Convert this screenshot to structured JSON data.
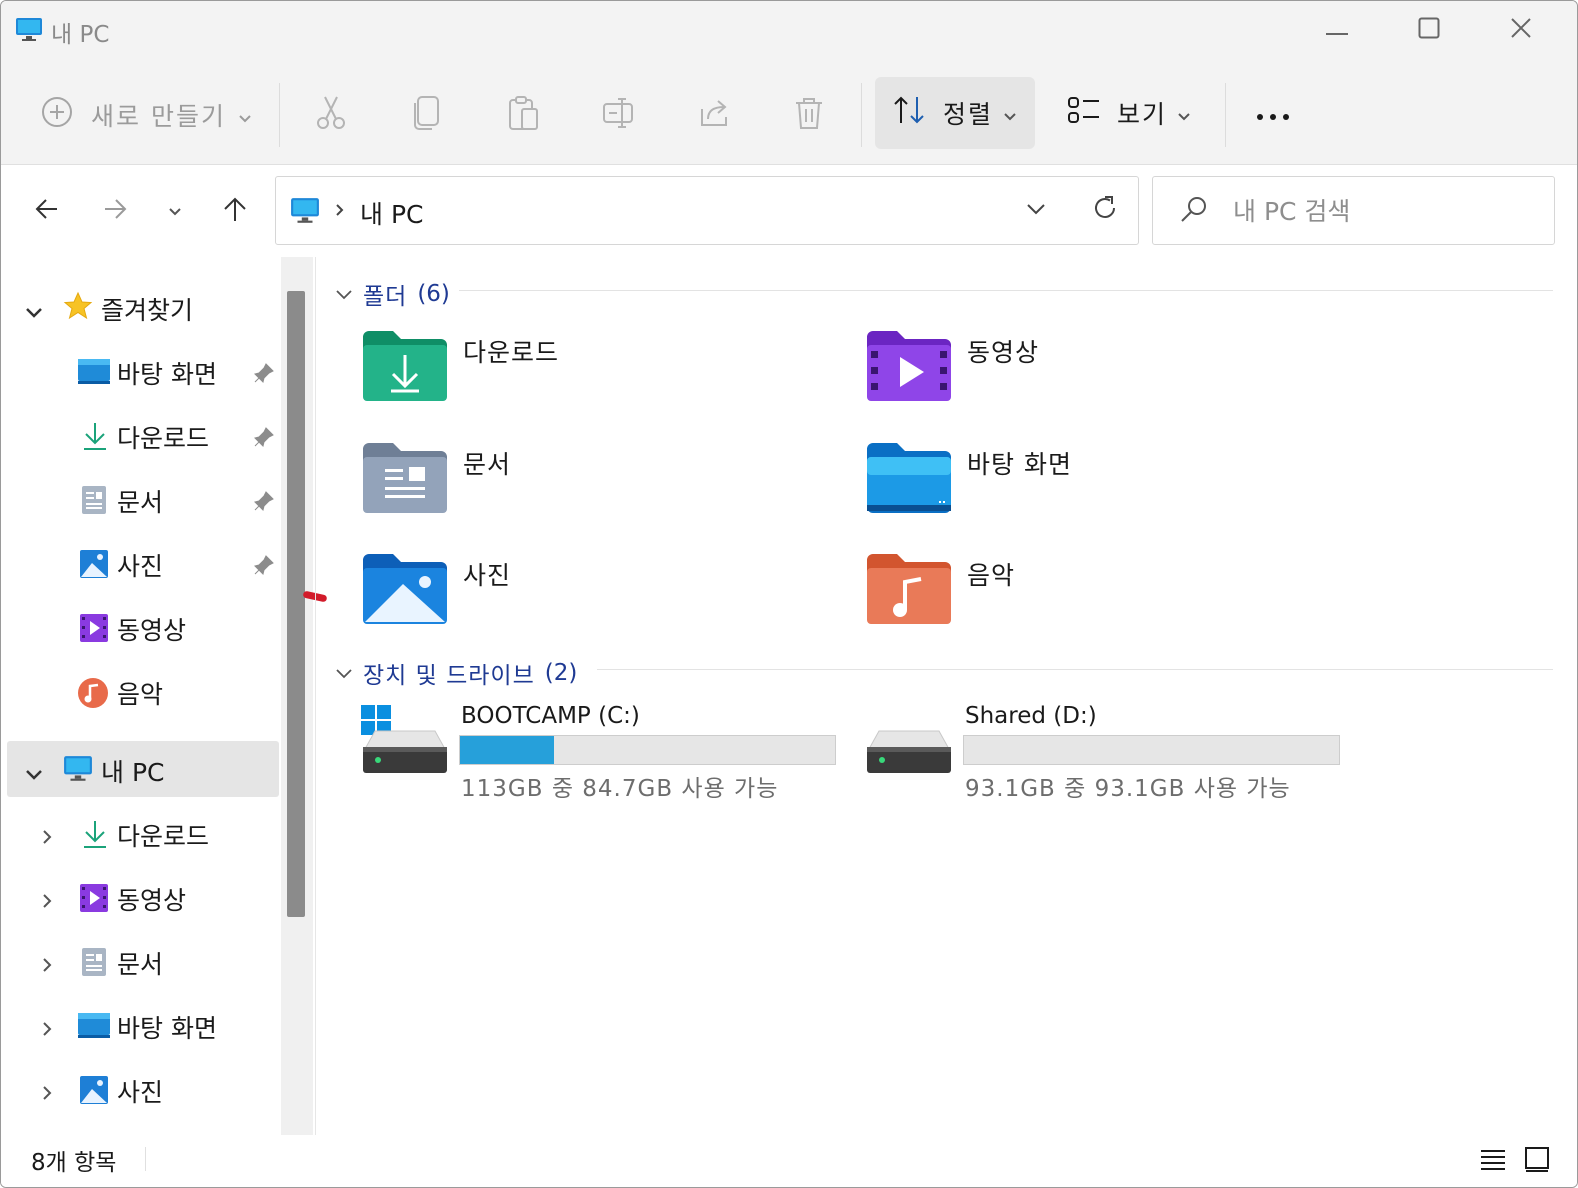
{
  "window": {
    "title": "내 PC",
    "icons": {
      "app": "monitor-icon",
      "minimize": "minimize-icon",
      "maximize": "maximize-icon",
      "close": "close-icon"
    }
  },
  "toolbar": {
    "new_label": "새로 만들기",
    "sort_label": "정렬",
    "view_label": "보기",
    "icons": [
      "plus-circle-icon",
      "cut-icon",
      "copy-icon",
      "paste-icon",
      "rename-icon",
      "share-icon",
      "delete-icon",
      "sort-icon",
      "view-icon",
      "more-icon"
    ]
  },
  "address": {
    "crumb": "내 PC",
    "search_placeholder": "내 PC 검색"
  },
  "sidebar": {
    "favorites_label": "즐겨찾기",
    "favorites": [
      {
        "label": "바탕 화면",
        "icon": "desktop-folder-icon",
        "pinned": true
      },
      {
        "label": "다운로드",
        "icon": "download-icon",
        "pinned": true
      },
      {
        "label": "문서",
        "icon": "document-icon",
        "pinned": true
      },
      {
        "label": "사진",
        "icon": "pictures-icon",
        "pinned": true
      },
      {
        "label": "동영상",
        "icon": "video-icon",
        "pinned": false
      },
      {
        "label": "음악",
        "icon": "music-icon",
        "pinned": false
      }
    ],
    "thispc_label": "내 PC",
    "thispc_children": [
      {
        "label": "다운로드",
        "icon": "download-icon"
      },
      {
        "label": "동영상",
        "icon": "video-icon"
      },
      {
        "label": "문서",
        "icon": "document-icon"
      },
      {
        "label": "바탕 화면",
        "icon": "desktop-folder-icon"
      },
      {
        "label": "사진",
        "icon": "pictures-icon"
      }
    ]
  },
  "content": {
    "folders_header": "폴더",
    "folders_count": "(6)",
    "folders": [
      {
        "label": "다운로드",
        "icon": "downloads-folder-icon"
      },
      {
        "label": "동영상",
        "icon": "videos-folder-icon"
      },
      {
        "label": "문서",
        "icon": "documents-folder-icon"
      },
      {
        "label": "바탕 화면",
        "icon": "desktop-folder-icon"
      },
      {
        "label": "사진",
        "icon": "pictures-folder-icon"
      },
      {
        "label": "음악",
        "icon": "music-folder-icon"
      }
    ],
    "drives_header": "장치 및 드라이브",
    "drives_count": "(2)",
    "drives": [
      {
        "name": "BOOTCAMP (C:)",
        "free_text": "113GB 중 84.7GB 사용 가능",
        "used_fraction": 0.25,
        "icon": "windows-drive-icon"
      },
      {
        "name": "Shared (D:)",
        "free_text": "93.1GB 중 93.1GB 사용 가능",
        "used_fraction": 0.0,
        "icon": "drive-icon"
      }
    ]
  },
  "status": {
    "item_count": "8개 항목",
    "icons": [
      "details-view-icon",
      "large-icons-view-icon"
    ]
  },
  "colors": {
    "accent": "#26a0da",
    "group_header": "#1f3a93",
    "selection": "#e5e5e5"
  }
}
